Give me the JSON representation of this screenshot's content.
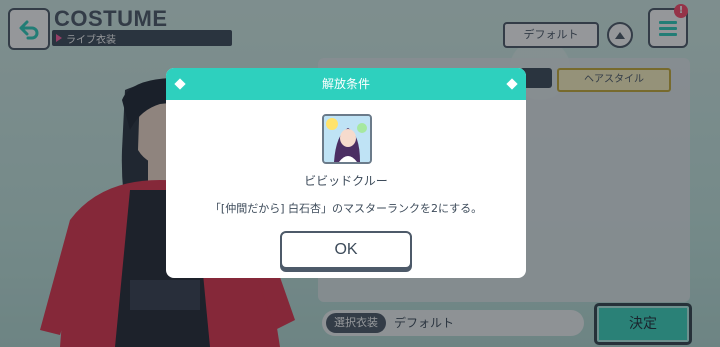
{
  "header": {
    "title": "COSTUME",
    "subtitle": "ライブ衣装",
    "default_label": "デフォルト",
    "badge": "!"
  },
  "tabs": {
    "hairstyle_label": "ヘアスタイル"
  },
  "bottom": {
    "selected_label": "選択衣装",
    "selected_value": "デフォルト",
    "decide_label": "決定"
  },
  "dialog": {
    "title": "解放条件",
    "reward_name": "ビビッドクルー",
    "condition": "「[仲間だから] 白石杏」のマスターランクを2にする。",
    "ok_label": "OK"
  },
  "icons": [
    "back-arrow-icon",
    "up-chevron-icon",
    "menu-icon",
    "character-portrait"
  ]
}
